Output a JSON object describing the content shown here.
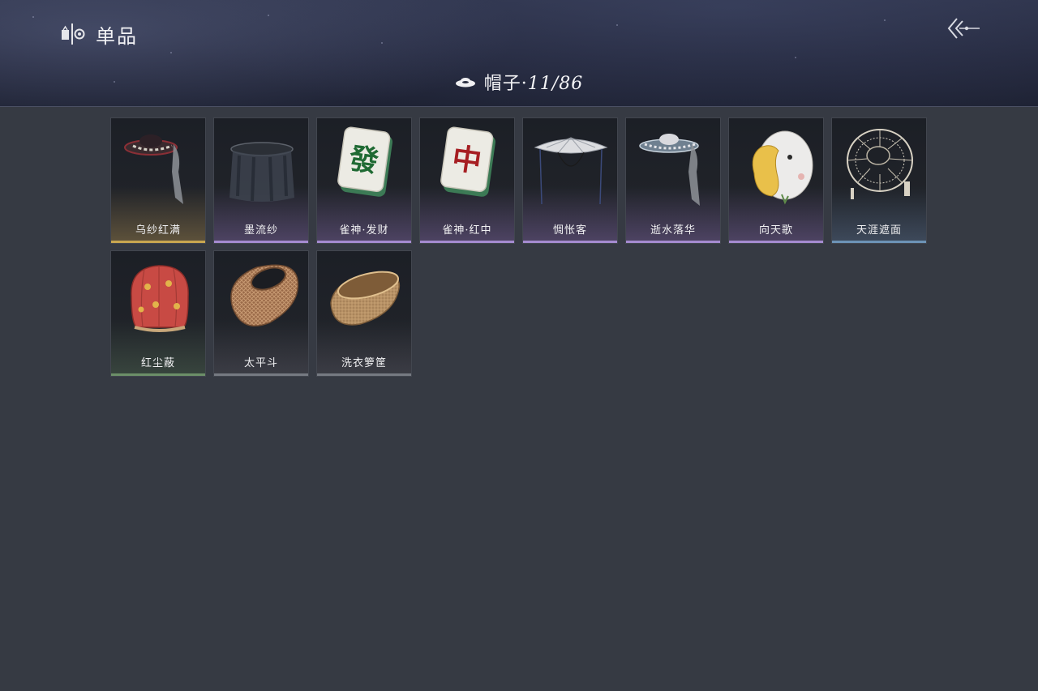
{
  "header": {
    "section_title": "单品",
    "section_icon": "wardrobe-icon",
    "back_icon": "back-arrow-icon"
  },
  "category": {
    "icon": "hat-icon",
    "name": "帽子·",
    "count": "11/86"
  },
  "items": [
    {
      "name": "乌纱红满",
      "quality": "gold",
      "icon": "gauze-hat-red-veil-icon"
    },
    {
      "name": "墨流纱",
      "quality": "purple",
      "icon": "black-veil-hat-icon"
    },
    {
      "name": "雀神·发财",
      "quality": "purple",
      "icon": "mahjong-tile-fa-icon",
      "tile_char": "發"
    },
    {
      "name": "雀神·红中",
      "quality": "purple",
      "icon": "mahjong-tile-zhong-icon",
      "tile_char": "中"
    },
    {
      "name": "惆怅客",
      "quality": "purple",
      "icon": "white-bamboo-hat-icon"
    },
    {
      "name": "逝水落华",
      "quality": "purple",
      "icon": "floral-veil-hat-icon"
    },
    {
      "name": "向天歌",
      "quality": "purple",
      "icon": "goose-hood-icon"
    },
    {
      "name": "天涯遮面",
      "quality": "blue",
      "icon": "rattan-veil-hat-icon"
    },
    {
      "name": "红尘蔽",
      "quality": "green",
      "icon": "red-cloth-hood-icon"
    },
    {
      "name": "太平斗",
      "quality": "gray",
      "icon": "woven-basket-hat-icon"
    },
    {
      "name": "洗衣箩筐",
      "quality": "gray",
      "icon": "laundry-basket-icon"
    }
  ],
  "colors": {
    "background": "#363a43",
    "gold": "#c8a650",
    "purple": "#a58bd0",
    "blue": "#6d93b6",
    "green": "#6c8f68",
    "gray": "#767a82"
  }
}
